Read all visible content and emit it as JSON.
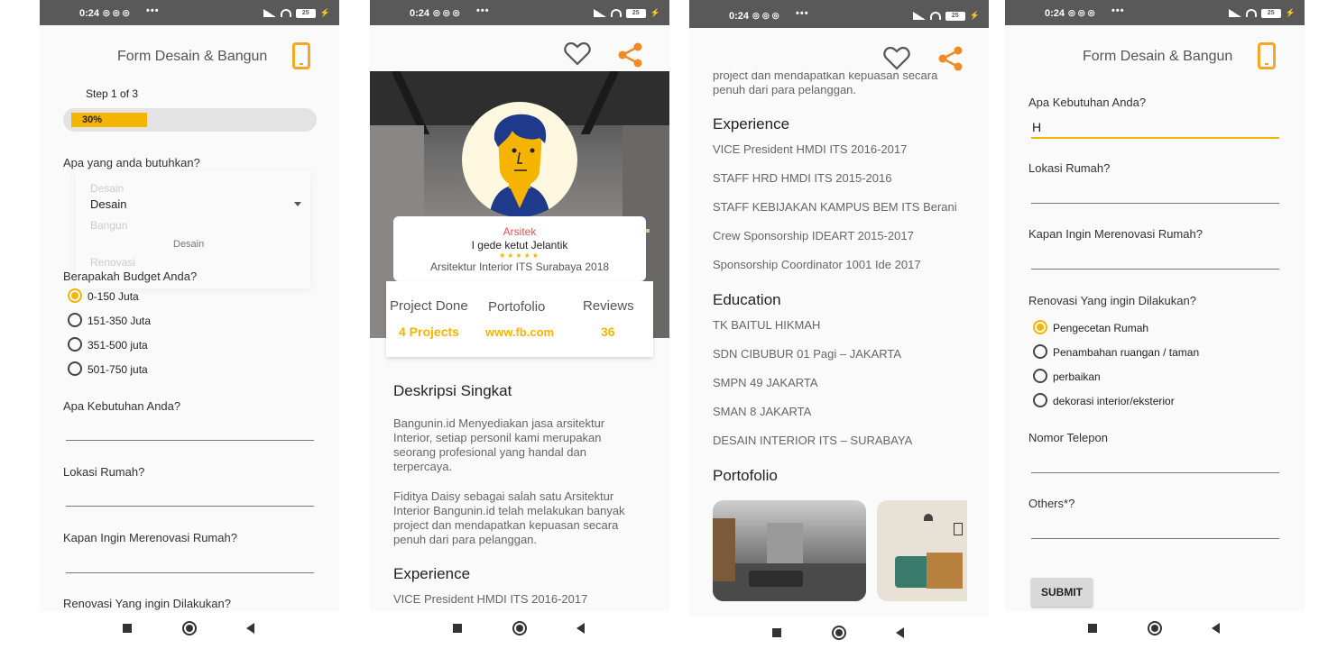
{
  "status": {
    "time": "0:24",
    "battery": "25"
  },
  "form": {
    "title": "Form Desain & Bangun",
    "step": "Step 1 of 3",
    "progress_label": "30%",
    "progress": 0.3,
    "q_need": "Apa yang anda butuhkan?",
    "dropdown_selected": "Desain",
    "dropdown_options": [
      "Desain",
      "Bangun",
      "Desain",
      "Renovasi"
    ],
    "q_budget": "Berapakah Budget Anda?",
    "budget_options": [
      "0-150 Juta",
      "151-350 Juta",
      "351-500 juta",
      "501-750 juta"
    ],
    "q_kebutuhan": "Apa Kebutuhan Anda?",
    "q_lokasi": "Lokasi Rumah?",
    "q_kapan": "Kapan Ingin Merenovasi Rumah?",
    "q_renovasi": "Renovasi Yang ingin Dilakukan?",
    "kebutuhan_value": "H",
    "renovasi_options": [
      "Pengecetan Rumah",
      "Penambahan ruangan / taman",
      "perbaikan",
      "dekorasi interior/eksterior"
    ],
    "q_telepon": "Nomor Telepon",
    "q_others": "Others*?",
    "submit": "SUBMIT"
  },
  "profile": {
    "role": "Arsitek",
    "name": "I gede ketut Jelantik",
    "stars": "★★★★★",
    "school": "Arsitektur Interior ITS Surabaya 2018",
    "stats": [
      {
        "label": "Project Done",
        "value": "4 Projects"
      },
      {
        "label": "Portofolio",
        "value": "www.fb.com"
      },
      {
        "label": "Reviews",
        "value": "36"
      }
    ],
    "desc_title": "Deskripsi Singkat",
    "desc_p1": "Bangunin.id Menyediakan jasa arsitektur Interior, setiap personil kami merupakan seorang profesional yang handal dan terpercaya.",
    "desc_p2": "Fiditya Daisy sebagai salah satu Arsitektur Interior Bangunin.id telah melakukan banyak project dan mendapatkan kepuasan secara penuh dari para pelanggan.",
    "desc_tail1": "project dan mendapatkan kepuasan secara",
    "desc_tail2": "penuh dari para pelanggan.",
    "exp_title": "Experience",
    "experience": [
      "VICE President HMDI ITS 2016-2017",
      "STAFF HRD HMDI ITS 2015-2016",
      "STAFF KEBIJAKAN KAMPUS BEM ITS Berani",
      "Crew Sponsorship IDEART 2015-2017",
      "Sponsorship Coordinator 1001 Ide 2017"
    ],
    "edu_title": "Education",
    "education": [
      "TK BAITUL HIKMAH",
      "SDN CIBUBUR 01 Pagi – JAKARTA",
      "SMPN 49 JAKARTA",
      "SMAN 8 JAKARTA",
      "DESAIN INTERIOR ITS – SURABAYA"
    ],
    "porto_title": "Portofolio"
  },
  "colors": {
    "accent": "#f5b400",
    "orange": "#f08a24",
    "statusbar": "#595959",
    "role": "#d9534f"
  }
}
